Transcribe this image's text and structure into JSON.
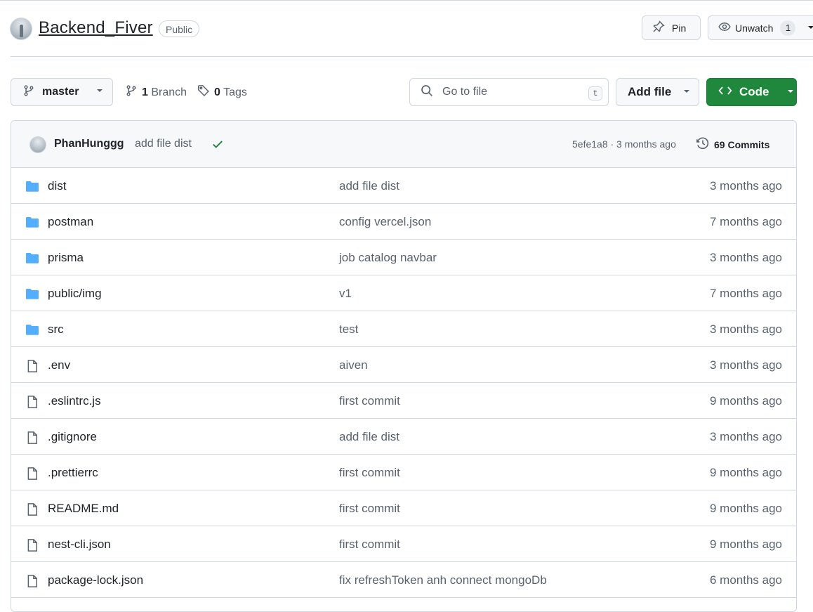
{
  "repo": {
    "name": "Backend_Fiver",
    "visibility": "Public"
  },
  "actions": {
    "pin_label": "Pin",
    "watch_label": "Unwatch",
    "watch_count": "1"
  },
  "toolbar": {
    "branch_name": "master",
    "branch_count": "1",
    "branch_label": "Branch",
    "tag_count": "0",
    "tag_label": "Tags",
    "search_placeholder": "Go to file",
    "search_shortcut": "t",
    "add_file_label": "Add file",
    "code_label": "Code"
  },
  "latest_commit": {
    "author": "PhanHunggg",
    "message": "add file dist",
    "meta": "5efe1a8 · 3 months ago",
    "commits_count": "69",
    "commits_label": "Commits"
  },
  "files": [
    {
      "name": "dist",
      "type": "folder",
      "message": "add file dist",
      "date": "3 months ago"
    },
    {
      "name": "postman",
      "type": "folder",
      "message": "config vercel.json",
      "date": "7 months ago"
    },
    {
      "name": "prisma",
      "type": "folder",
      "message": "job catalog navbar",
      "date": "3 months ago"
    },
    {
      "name": "public/img",
      "type": "folder",
      "message": "v1",
      "date": "7 months ago"
    },
    {
      "name": "src",
      "type": "folder",
      "message": "test",
      "date": "3 months ago"
    },
    {
      "name": ".env",
      "type": "file",
      "message": "aiven",
      "date": "3 months ago"
    },
    {
      "name": ".eslintrc.js",
      "type": "file",
      "message": "first commit",
      "date": "9 months ago"
    },
    {
      "name": ".gitignore",
      "type": "file",
      "message": "add file dist",
      "date": "3 months ago"
    },
    {
      "name": ".prettierrc",
      "type": "file",
      "message": "first commit",
      "date": "9 months ago"
    },
    {
      "name": "README.md",
      "type": "file",
      "message": "first commit",
      "date": "9 months ago"
    },
    {
      "name": "nest-cli.json",
      "type": "file",
      "message": "first commit",
      "date": "9 months ago"
    },
    {
      "name": "package-lock.json",
      "type": "file",
      "message": "fix refreshToken anh connect mongoDb",
      "date": "6 months ago"
    }
  ],
  "colors": {
    "accent_green": "#1f883d",
    "folder_blue": "#54aeff",
    "check_green": "#1a7f37"
  }
}
